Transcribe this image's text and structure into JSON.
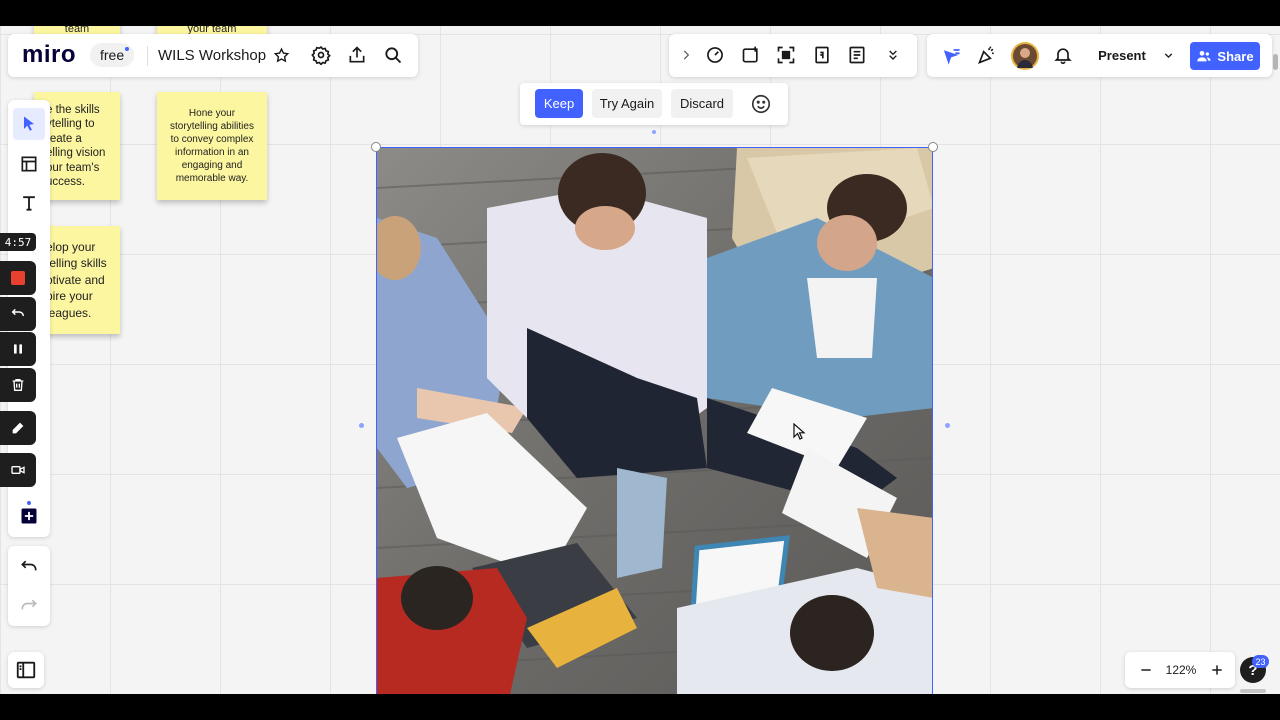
{
  "header": {
    "logo": "miro",
    "plan_badge": "free",
    "board_title": "WILS Workshop",
    "present_label": "Present",
    "share_label": "Share",
    "top_edge_sticky_left": "team",
    "top_edge_sticky_right": "your team"
  },
  "stickies": {
    "note1": "e the skills\nytelling to\nreate a\nelling vision\nour team's\nuccess.",
    "note2": "Hone your\nstorytelling abilities\nto convey complex\ninformation in an\nengaging and\nmemorable way.",
    "note3": "elop your\ntelling skills\notivate and\npire your\nleagues."
  },
  "ai_actions": {
    "keep": "Keep",
    "try_again": "Try Again",
    "discard": "Discard"
  },
  "recorder": {
    "timer": "4:57"
  },
  "zoom": {
    "level": "122%"
  },
  "help": {
    "badge_count": "23"
  },
  "colors": {
    "accent": "#4262ff",
    "sticky": "#fcf6a0",
    "record_red": "#e8412f"
  },
  "icons": {
    "tools": [
      "cursor-icon",
      "frame-icon",
      "text-icon",
      "plus-square-icon",
      "undo-icon",
      "redo-icon"
    ],
    "header": [
      "settings-icon",
      "export-icon",
      "search-icon",
      "star-icon"
    ],
    "toolbar": [
      "chevron-right-icon",
      "timer-icon",
      "comment-add-icon",
      "focus-icon",
      "card-icon",
      "notes-icon",
      "chevrons-down-icon"
    ],
    "collab": [
      "reactions-filter-icon",
      "celebrate-icon",
      "avatar",
      "bell-icon",
      "chevron-down-icon",
      "people-icon"
    ]
  }
}
